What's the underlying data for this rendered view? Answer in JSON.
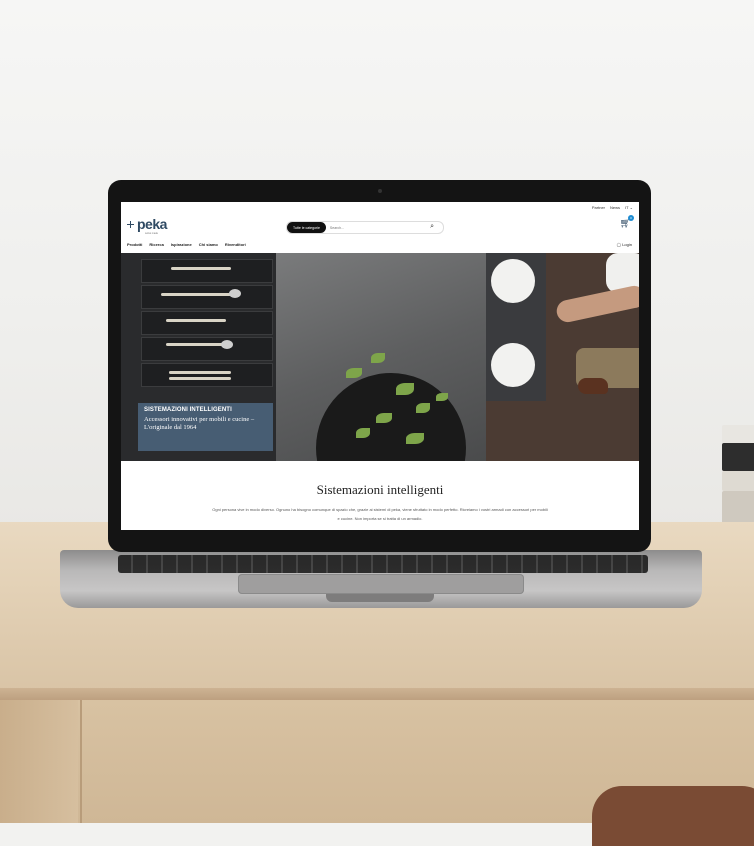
{
  "site": {
    "brand": "peka",
    "brand_sub": "swiss made",
    "util_nav": [
      "Partner",
      "News",
      "IT"
    ],
    "search": {
      "category_label": "Tutte le categorie",
      "placeholder": "Search..."
    },
    "cart_count": "0",
    "main_nav": [
      "Prodotti",
      "Ricerca",
      "Ispirazione",
      "Chi siamo",
      "Rivenditori"
    ],
    "login_label": "Login",
    "hero": {
      "badge_title": "SISTEMAZIONI INTELLIGENTI",
      "badge_text": "Accessori innovativi per mobili e cucine – L'originale dal 1964"
    },
    "section": {
      "title": "Sistemazioni intelligenti",
      "text": "Ogni persona vive in modo diverso. Ognuno ha bisogno comunque di spazio che, grazie ai sistemi di peka, viene sfruttato in modo perfetto. Ricreiamo i vostri armadi con accessori per mobili e cucine. Non importa se si tratta di un armadio."
    }
  },
  "colors": {
    "brand": "#2f4a63",
    "accent": "#1e8cd2",
    "hero_card": "#4a627a"
  }
}
